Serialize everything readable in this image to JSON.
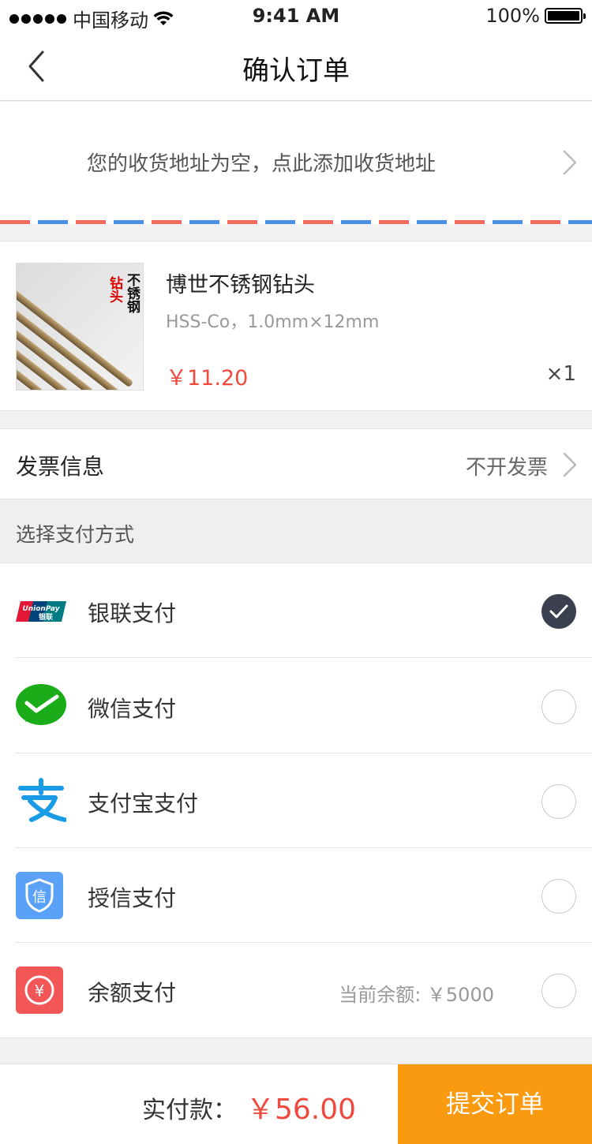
{
  "status_bar": {
    "carrier": "中国移动",
    "time": "9:41 AM",
    "battery": "100%",
    "battery_level": 1.0
  },
  "nav": {
    "title": "确认订单",
    "back_icon": "chevron-left-icon"
  },
  "address": {
    "placeholder_text": "您的收货地址为空，点此添加收货地址"
  },
  "product": {
    "name": "博世不锈钢钻头",
    "spec": "HSS-Co，1.0mm×12mm",
    "price": "￥11.20",
    "quantity": "×1",
    "image_text_black": "不锈钢",
    "image_text_red": "钻头"
  },
  "invoice": {
    "label": "发票信息",
    "value": "不开发票"
  },
  "payment": {
    "header": "选择支付方式",
    "methods": [
      {
        "label": "银联支付",
        "icon": "unionpay-icon",
        "checked": true,
        "extra": ""
      },
      {
        "label": "微信支付",
        "icon": "wechat-pay-icon",
        "checked": false,
        "extra": ""
      },
      {
        "label": "支付宝支付",
        "icon": "alipay-icon",
        "checked": false,
        "extra": ""
      },
      {
        "label": "授信支付",
        "icon": "credit-shield-icon",
        "checked": false,
        "extra": ""
      },
      {
        "label": "余额支付",
        "icon": "balance-yen-icon",
        "checked": false,
        "extra": "当前余额: ￥5000"
      }
    ],
    "unionpay_logo_text": "UnionPay",
    "unionpay_logo_cn": "银联",
    "credit_icon_text": "信",
    "balance_icon_text": "¥"
  },
  "footer": {
    "total_label": "实付款：",
    "total_value": "￥56.00",
    "submit_label": "提交订单"
  },
  "colors": {
    "accent_orange": "#fa9a10",
    "price_red": "#f04a3e",
    "checked_dark": "#3a4050",
    "wechat_green": "#1aad19",
    "alipay_blue": "#1a9be6",
    "credit_blue": "#5aa2f7",
    "balance_red": "#f25656"
  }
}
